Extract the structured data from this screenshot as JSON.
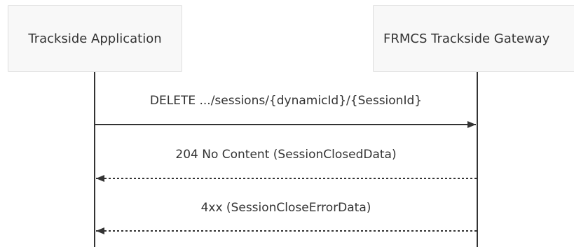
{
  "participants": {
    "left": "Trackside Application",
    "right": "FRMCS Trackside Gateway"
  },
  "messages": [
    {
      "label": "DELETE .../sessions/{dynamicId}/{SessionId}",
      "style": "solid",
      "direction": "left-to-right"
    },
    {
      "label": "204 No Content (SessionClosedData)",
      "style": "dashed",
      "direction": "right-to-left"
    },
    {
      "label": "4xx (SessionCloseErrorData)",
      "style": "dashed",
      "direction": "right-to-left"
    }
  ],
  "colors": {
    "line": "#333333",
    "actor_fill": "#f8f8f8",
    "actor_border": "#dedede"
  }
}
